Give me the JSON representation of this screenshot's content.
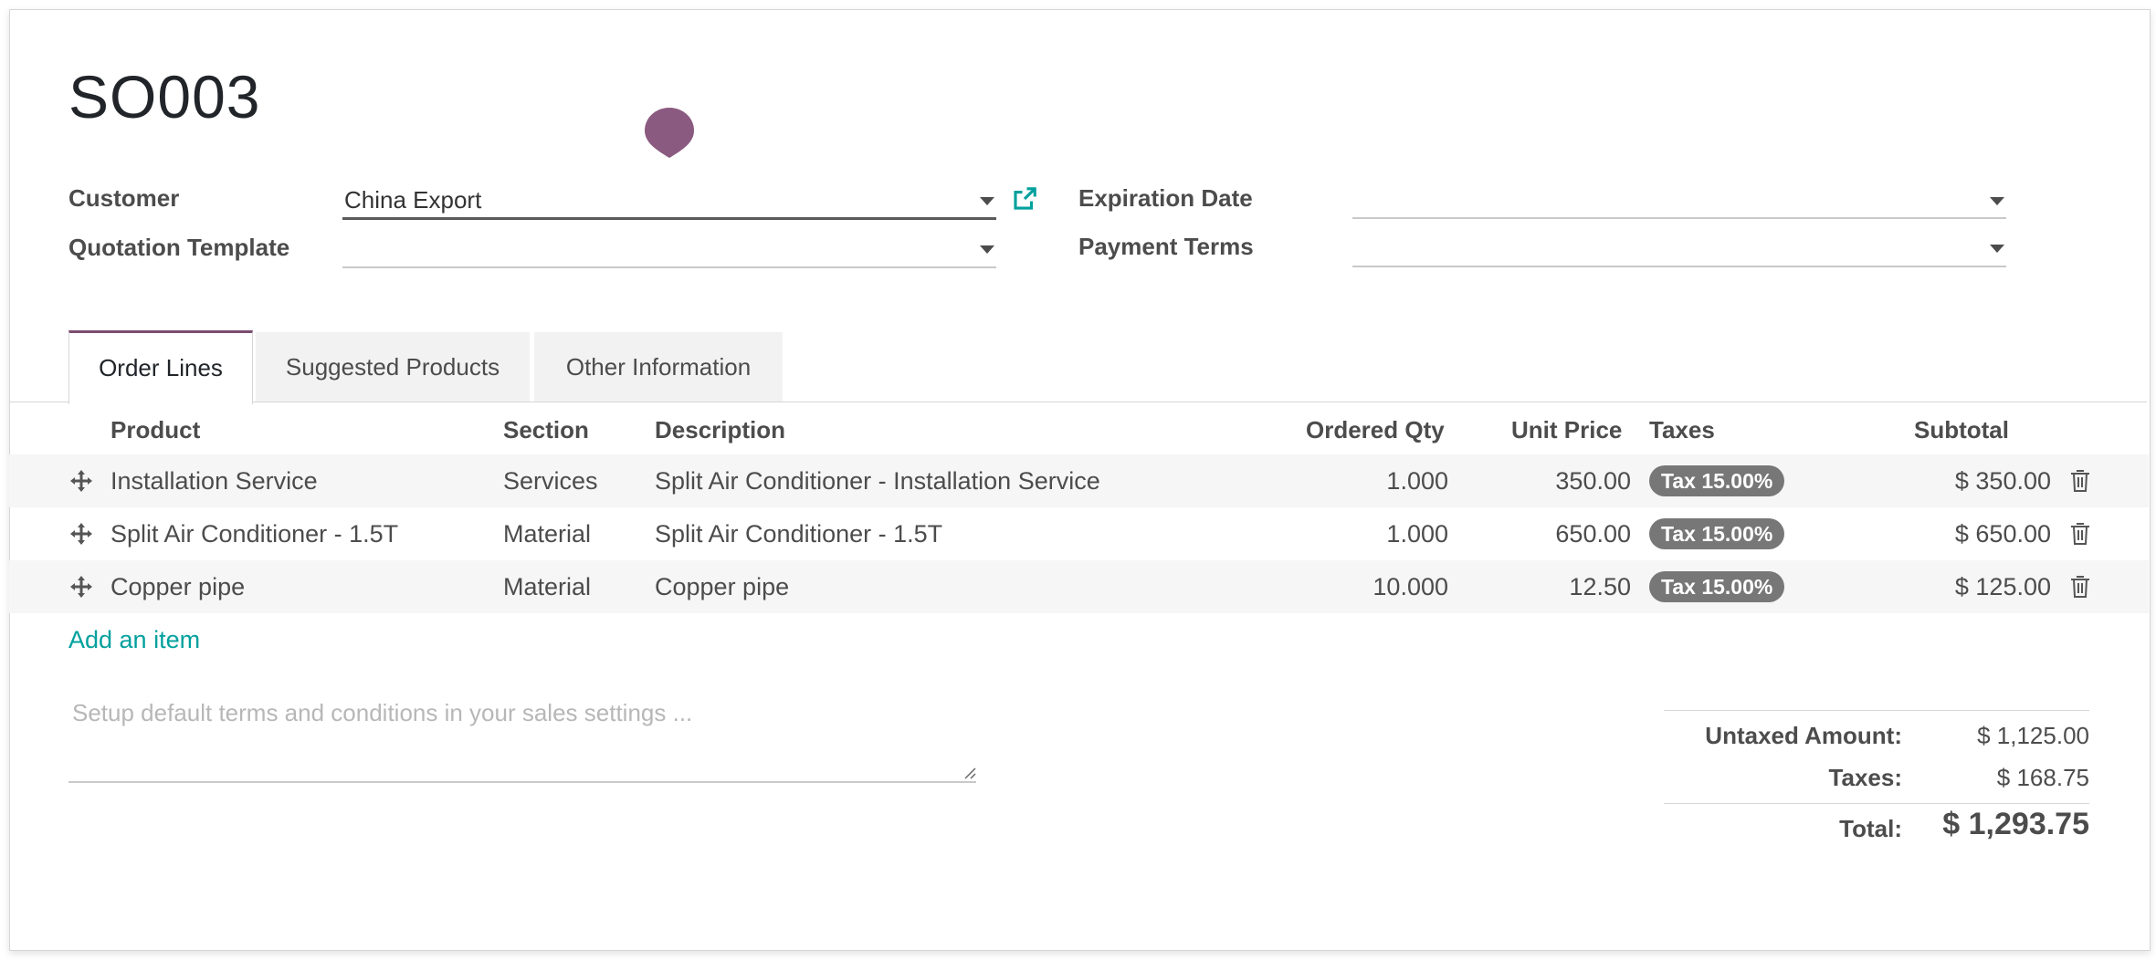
{
  "record": {
    "name": "SO003"
  },
  "fields": {
    "customer": {
      "label": "Customer",
      "value": "China Export"
    },
    "quotation_template": {
      "label": "Quotation Template",
      "value": ""
    },
    "expiration_date": {
      "label": "Expiration Date",
      "value": ""
    },
    "payment_terms": {
      "label": "Payment Terms",
      "value": ""
    }
  },
  "tabs": [
    {
      "label": "Order Lines",
      "active": true
    },
    {
      "label": "Suggested Products",
      "active": false
    },
    {
      "label": "Other Information",
      "active": false
    }
  ],
  "table": {
    "headers": {
      "product": "Product",
      "section": "Section",
      "description": "Description",
      "ordered_qty": "Ordered Qty",
      "unit_price": "Unit Price",
      "taxes": "Taxes",
      "subtotal": "Subtotal"
    },
    "rows": [
      {
        "product": "Installation Service",
        "section": "Services",
        "description": "Split Air Conditioner - Installation Service",
        "qty": "1.000",
        "price": "350.00",
        "tax": "Tax 15.00%",
        "subtotal": "$ 350.00"
      },
      {
        "product": "Split Air Conditioner - 1.5T",
        "section": "Material",
        "description": "Split Air Conditioner - 1.5T",
        "qty": "1.000",
        "price": "650.00",
        "tax": "Tax 15.00%",
        "subtotal": "$ 650.00"
      },
      {
        "product": "Copper pipe",
        "section": "Material",
        "description": "Copper pipe",
        "qty": "10.000",
        "price": "12.50",
        "tax": "Tax 15.00%",
        "subtotal": "$ 125.00"
      }
    ],
    "add_item": "Add an item"
  },
  "notes": {
    "placeholder": "Setup default terms and conditions in your sales settings ..."
  },
  "totals": {
    "untaxed_label": "Untaxed Amount:",
    "untaxed_value": "$ 1,125.00",
    "taxes_label": "Taxes:",
    "taxes_value": "$ 168.75",
    "total_label": "Total:",
    "total_value": "$ 1,293.75"
  },
  "colors": {
    "accent": "#7c4d70",
    "link": "#00a09d",
    "badge": "#777777",
    "pin": "#8a5a80"
  },
  "icons": [
    "map-pin-icon",
    "external-link-icon",
    "drag-handle-icon",
    "trash-icon",
    "dropdown-caret-icon",
    "resize-handle-icon"
  ]
}
